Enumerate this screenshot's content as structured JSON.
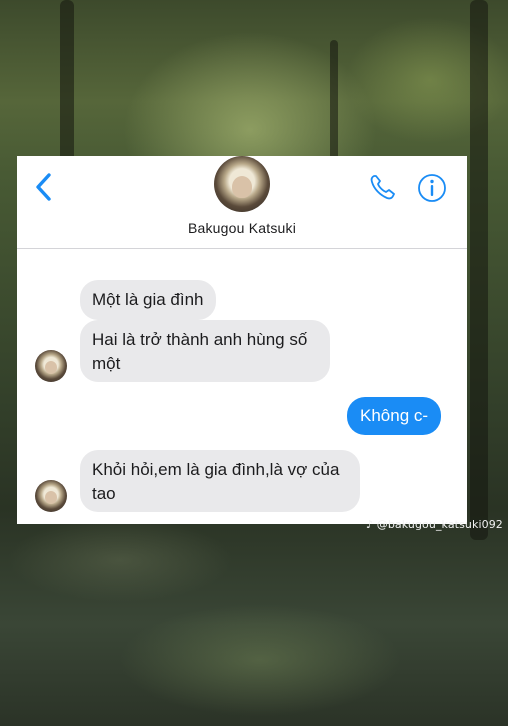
{
  "contact": {
    "name": "Bakugou Katsuki"
  },
  "header": {
    "back_icon": "chevron-left-icon",
    "call_icon": "phone-icon",
    "info_icon": "info-icon",
    "accent_color": "#1a8cf5"
  },
  "messages": [
    {
      "sender": "them",
      "text": "Một là gia đình"
    },
    {
      "sender": "them",
      "text": "Hai là trở thành anh hùng số một"
    },
    {
      "sender": "me",
      "text": "Không c-"
    },
    {
      "sender": "them",
      "text": "Khỏi hỏi,em là gia đình,là vợ của tao"
    }
  ],
  "colors": {
    "incoming_bubble": "#e9e9eb",
    "outgoing_bubble": "#1a8cf5"
  },
  "watermark": {
    "text": "@bakugou_katsuki092",
    "icon": "tiktok-icon"
  }
}
